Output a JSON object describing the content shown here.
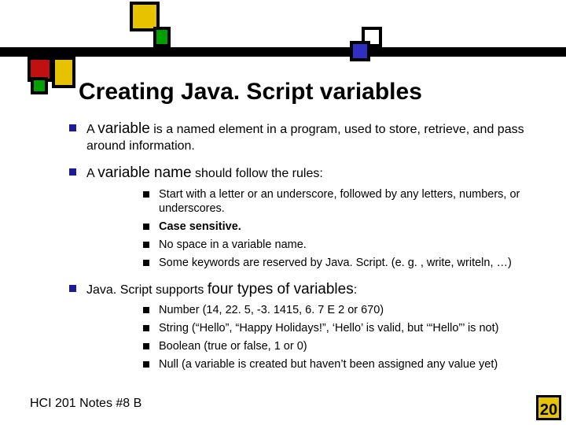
{
  "title": "Creating Java. Script variables",
  "bullets": [
    {
      "pre": "A ",
      "name": "variable",
      "post": " is a named element in a program, used to store, retrieve, and pass around information."
    },
    {
      "pre": "A ",
      "name": "variable name",
      "post": " should follow the rules:",
      "sub": [
        "Start with a letter or an underscore, followed by any letters, numbers, or underscores.",
        "Case sensitive.",
        "No space in a variable name.",
        "Some keywords are reserved by Java. Script. (e. g. , write, writeln, …)"
      ],
      "sub_bold": [
        false,
        true,
        false,
        false
      ]
    },
    {
      "pre": "Java. Script supports ",
      "name": "four types of variables",
      "post": ":",
      "sub": [
        "Number (14, 22. 5, -3. 1415, 6. 7 E 2 or 670)",
        "String (“Hello”, “Happy Holidays!”, ‘Hello’ is valid, but ‘“Hello”’ is not)",
        "Boolean (true or false, 1 or 0)",
        "Null (a variable is created but haven’t been assigned any value yet)"
      ]
    }
  ],
  "footer": "HCI 201 Notes #8 B",
  "page": "20"
}
